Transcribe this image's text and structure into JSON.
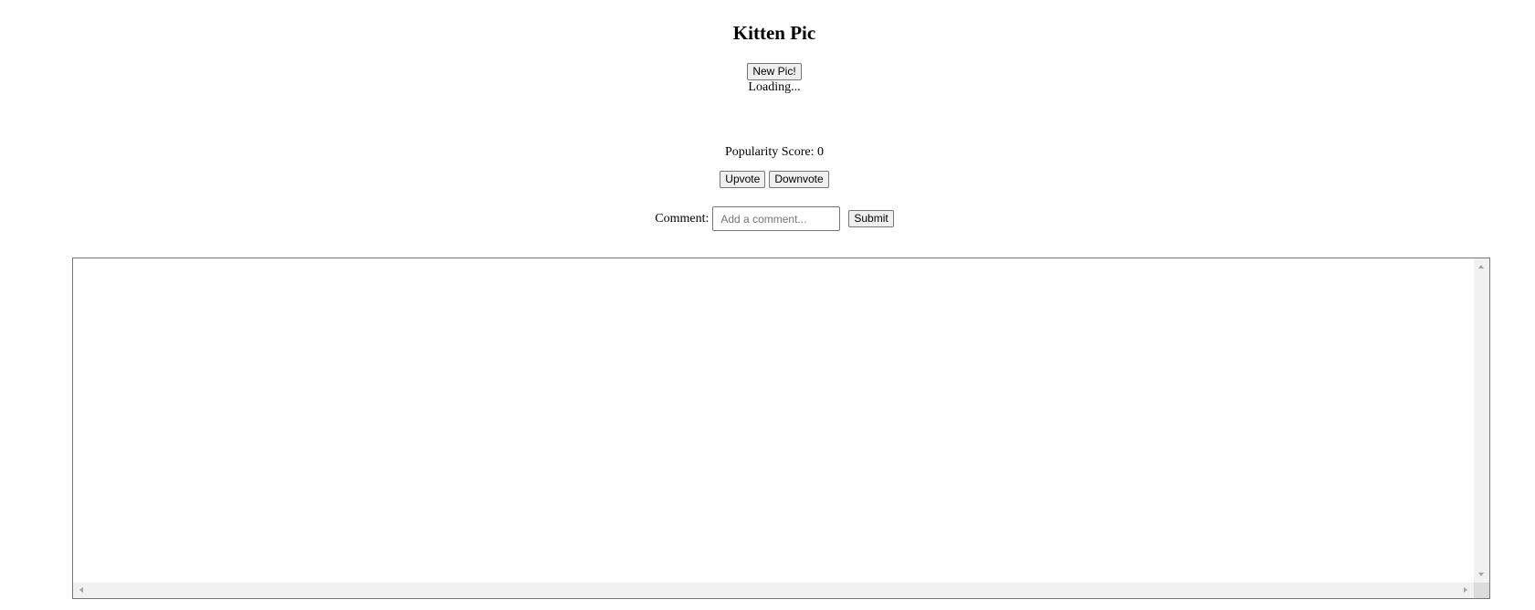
{
  "page": {
    "title": "Kitten Pic"
  },
  "image_section": {
    "new_pic_label": "New Pic!",
    "loading_text": "Loading..."
  },
  "popularity": {
    "label": "Popularity Score:",
    "score": "0",
    "upvote_label": "Upvote",
    "downvote_label": "Downvote"
  },
  "comment": {
    "label": "Comment:",
    "value": "",
    "placeholder": "Add a comment...",
    "submit_label": "Submit"
  },
  "comments_area": {
    "content": ""
  },
  "icons": {
    "scroll_up": "scroll-up-arrow-icon",
    "scroll_down": "scroll-down-arrow-icon",
    "scroll_left": "scroll-left-arrow-icon",
    "scroll_right": "scroll-right-arrow-icon"
  }
}
